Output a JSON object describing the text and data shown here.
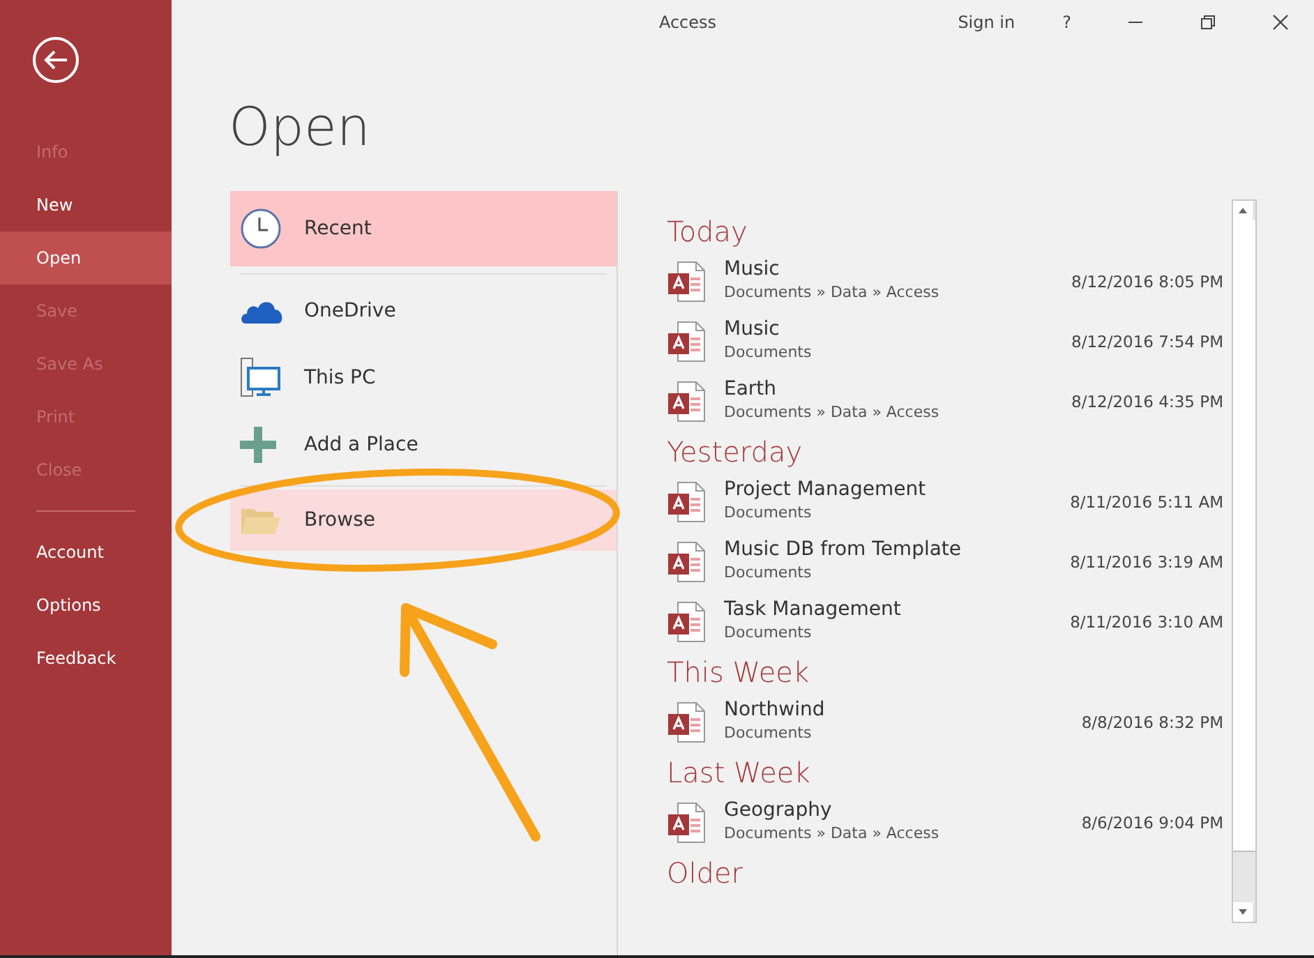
{
  "window": {
    "title": "Access",
    "sign_in": "Sign in",
    "help": "?"
  },
  "sidebar": {
    "items": [
      {
        "label": "Info",
        "disabled": true,
        "selected": false,
        "divider_before": false
      },
      {
        "label": "New",
        "disabled": false,
        "selected": false,
        "divider_before": false
      },
      {
        "label": "Open",
        "disabled": false,
        "selected": true,
        "divider_before": false
      },
      {
        "label": "Save",
        "disabled": true,
        "selected": false,
        "divider_before": false
      },
      {
        "label": "Save As",
        "disabled": true,
        "selected": false,
        "divider_before": false
      },
      {
        "label": "Print",
        "disabled": true,
        "selected": false,
        "divider_before": false
      },
      {
        "label": "Close",
        "disabled": true,
        "selected": false,
        "divider_before": false
      },
      {
        "label": "Account",
        "disabled": false,
        "selected": false,
        "divider_before": true
      },
      {
        "label": "Options",
        "disabled": false,
        "selected": false,
        "divider_before": false
      },
      {
        "label": "Feedback",
        "disabled": false,
        "selected": false,
        "divider_before": false
      }
    ]
  },
  "page_title": "Open",
  "places": [
    {
      "kind": "clock",
      "label": "Recent",
      "selected": true,
      "highlighted": false,
      "divider_before": false
    },
    {
      "kind": "cloud",
      "label": "OneDrive",
      "selected": false,
      "highlighted": false,
      "divider_before": true
    },
    {
      "kind": "computer",
      "label": "This PC",
      "selected": false,
      "highlighted": false,
      "divider_before": false
    },
    {
      "kind": "plus",
      "label": "Add a Place",
      "selected": false,
      "highlighted": false,
      "divider_before": false
    },
    {
      "kind": "folder",
      "label": "Browse",
      "selected": false,
      "highlighted": true,
      "divider_before": true
    }
  ],
  "recent": [
    {
      "heading": "Today",
      "files": [
        {
          "name": "Music",
          "path": "Documents » Data » Access",
          "date": "8/12/2016 8:05 PM"
        },
        {
          "name": "Music",
          "path": "Documents",
          "date": "8/12/2016 7:54 PM"
        },
        {
          "name": "Earth",
          "path": "Documents » Data » Access",
          "date": "8/12/2016 4:35 PM"
        }
      ]
    },
    {
      "heading": "Yesterday",
      "files": [
        {
          "name": "Project Management",
          "path": "Documents",
          "date": "8/11/2016 5:11 AM"
        },
        {
          "name": "Music DB from Template",
          "path": "Documents",
          "date": "8/11/2016 3:19 AM"
        },
        {
          "name": "Task Management",
          "path": "Documents",
          "date": "8/11/2016 3:10 AM"
        }
      ]
    },
    {
      "heading": "This Week",
      "files": [
        {
          "name": "Northwind",
          "path": "Documents",
          "date": "8/8/2016 8:32 PM"
        }
      ]
    },
    {
      "heading": "Last Week",
      "files": [
        {
          "name": "Geography",
          "path": "Documents » Data » Access",
          "date": "8/6/2016 9:04 PM"
        }
      ]
    },
    {
      "heading": "Older"
    }
  ]
}
